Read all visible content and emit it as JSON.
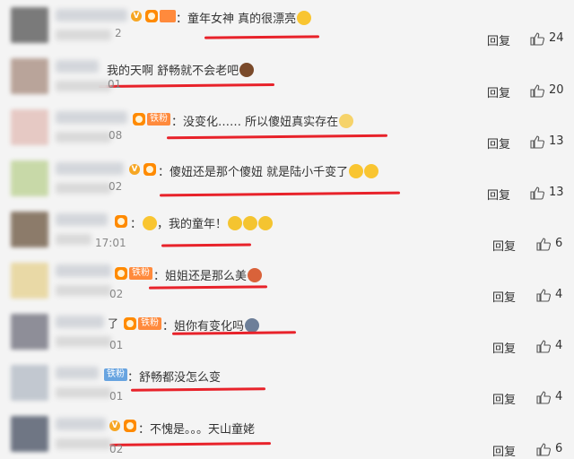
{
  "comments": [
    {
      "text": "：童年女神 真的很漂亮",
      "time_tail": "2",
      "reply": "回复",
      "likes": "24",
      "avatar_color": "#7a7a7a"
    },
    {
      "text": "我的天啊 舒畅就不会老吧",
      "time_tail": "01",
      "reply": "回复",
      "likes": "20",
      "avatar_color": "#b9a49a"
    },
    {
      "text": "：没变化…… 所以傻妞真实存在",
      "time_tail": "08",
      "reply": "回复",
      "likes": "13",
      "fan_badge": "铁粉",
      "avatar_color": "#e6c9c4"
    },
    {
      "text": "：傻妞还是那个傻妞 就是陆小千变了",
      "time_tail": "02",
      "reply": "回复",
      "likes": "13",
      "avatar_color": "#c8d9a8"
    },
    {
      "text": "：",
      "text2": "，我的童年！",
      "time_tail": "17:01",
      "reply": "回复",
      "likes": "6",
      "avatar_color": "#8c7b6a"
    },
    {
      "text": "：姐姐还是那么美",
      "time_tail": "02",
      "reply": "回复",
      "likes": "4",
      "fan_badge": "铁粉",
      "avatar_color": "#e9d9a6"
    },
    {
      "text": "：姐你有变化吗",
      "time_tail": "01",
      "reply": "回复",
      "likes": "4",
      "name_tail": "了",
      "fan_badge": "铁粉",
      "avatar_color": "#8e8e98"
    },
    {
      "text": "：舒畅都没怎么变",
      "time_tail": "01",
      "reply": "回复",
      "likes": "4",
      "fan_badge": "铁粉",
      "avatar_color": "#c2c8d0"
    },
    {
      "text": "：不愧是。。。天山童姥",
      "time_tail": "02",
      "reply": "回复",
      "likes": "6",
      "avatar_color": "#6f7684"
    }
  ],
  "colors": {
    "underline": "#e8222a",
    "fan_orange": "#ff8a3c",
    "fan_blue": "#68a4e0",
    "vip": "#f6a623"
  },
  "icons": {
    "like": "thumbs-up-icon",
    "vip": "vip-v-icon",
    "crown": "membership-badge-icon"
  }
}
